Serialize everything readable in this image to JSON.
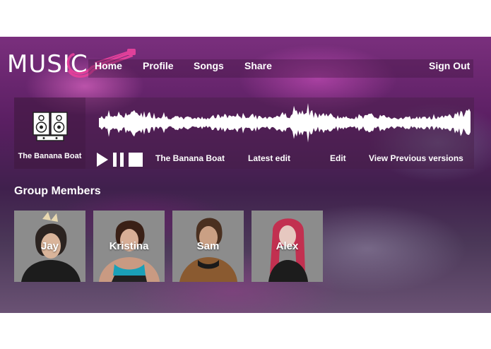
{
  "app": {
    "logo_text": "MUSIC",
    "accent_color": "#e0409a"
  },
  "nav": {
    "items": [
      {
        "label": "Home"
      },
      {
        "label": "Profile"
      },
      {
        "label": "Songs"
      },
      {
        "label": "Share"
      }
    ],
    "sign_out": "Sign Out"
  },
  "player": {
    "album_title": "The Banana Boat",
    "album_icon": "speaker-pair-icon",
    "track_title": "The Banana Boat",
    "latest_edit": "Latest edit",
    "edit": "Edit",
    "previous_versions": "View Previous versions",
    "controls": [
      "play-icon",
      "pause-icon",
      "stop-icon"
    ]
  },
  "members": {
    "title": "Group Members",
    "list": [
      {
        "name": "Jay"
      },
      {
        "name": "Kristina"
      },
      {
        "name": "Sam"
      },
      {
        "name": "Alex"
      }
    ]
  }
}
